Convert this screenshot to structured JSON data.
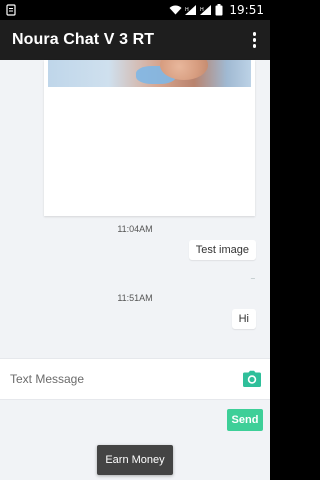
{
  "status_bar": {
    "time": "19:51",
    "icons": [
      "notification-icon",
      "wifi-icon",
      "signal-icon",
      "signal-icon",
      "battery-icon"
    ]
  },
  "app_bar": {
    "title": "Noura Chat V 3 RT",
    "menu_icon": "overflow-menu-icon"
  },
  "messages": [
    {
      "type": "image",
      "direction": "incoming"
    },
    {
      "type": "timestamp",
      "text": "11:04AM"
    },
    {
      "type": "text",
      "direction": "outgoing",
      "text": "Test image"
    },
    {
      "type": "timestamp",
      "text": "11:51AM"
    },
    {
      "type": "text",
      "direction": "outgoing",
      "text": "Hi"
    }
  ],
  "composer": {
    "placeholder": "Text Message",
    "value": "",
    "camera_icon": "camera-icon",
    "send_label": "Send"
  },
  "toast": {
    "label": "Earn Money"
  },
  "colors": {
    "app_bar": "#1e1e1e",
    "accent": "#3ecf98",
    "chat_background": "#f1f3f6"
  }
}
